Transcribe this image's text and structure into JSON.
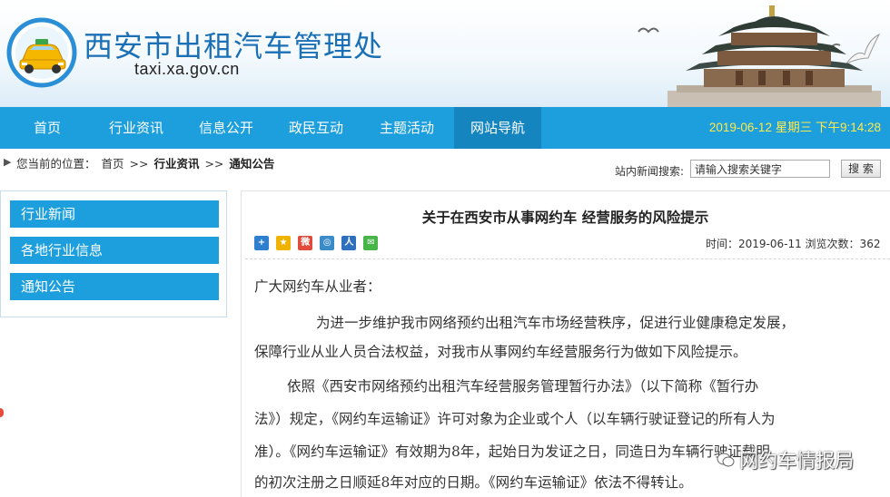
{
  "header": {
    "site_title": "西安市出租汽车管理处",
    "site_url": "taxi.xa.gov.cn"
  },
  "nav": {
    "items": [
      {
        "label": "首页"
      },
      {
        "label": "行业资讯"
      },
      {
        "label": "信息公开"
      },
      {
        "label": "政民互动"
      },
      {
        "label": "主题活动"
      },
      {
        "label": "网站导航"
      }
    ],
    "active_index": 5,
    "datetime": "2019-06-12 星期三 下午9:14:28"
  },
  "breadcrumb": {
    "prefix": "您当前的位置：",
    "home": "首页",
    "sep": ">>",
    "section": "行业资讯",
    "current": "通知公告"
  },
  "search": {
    "label": "站内新闻搜索:",
    "value": "请输入搜索关键字",
    "button": "搜 索"
  },
  "sidebar": {
    "items": [
      {
        "label": "行业新闻"
      },
      {
        "label": "各地行业信息"
      },
      {
        "label": "通知公告"
      }
    ]
  },
  "article": {
    "title": "关于在西安市从事网约车 经营服务的风险提示",
    "meta": "时间：2019-06-11 浏览次数：362",
    "share_icons": [
      "share-plus-icon",
      "qzone-icon",
      "weibo-icon",
      "tencent-icon",
      "renren-icon",
      "wechat-icon"
    ],
    "lines": [
      "广大网约车从业者：",
      "为进一步维护我市网络预约出租汽车市场经营秩序，促进行业健康稳定发展，",
      "保障行业从业人员合法权益，对我市从事网约车经营服务行为做如下风险提示。",
      "依照《西安市网络预约出租汽车经营服务管理暂行办法》（以下简称《暂行办",
      "法》）规定，《网约车运输证》许可对象为企业或个人（以车辆行驶证登记的所有人为",
      "准）。《网约车运输证》有效期为8年，起始日为发证之日，同造日为车辆行驶证载明",
      "的初次注册之日顺延8年对应的日期。《网约车运输证》依法不得转让。"
    ]
  },
  "watermark": {
    "text": "网约车情报局"
  },
  "colors": {
    "nav_bg": "#1d9fde",
    "nav_active": "#1585bf",
    "datetime": "#ffe94a",
    "title_blue": "#1a6fb5"
  }
}
